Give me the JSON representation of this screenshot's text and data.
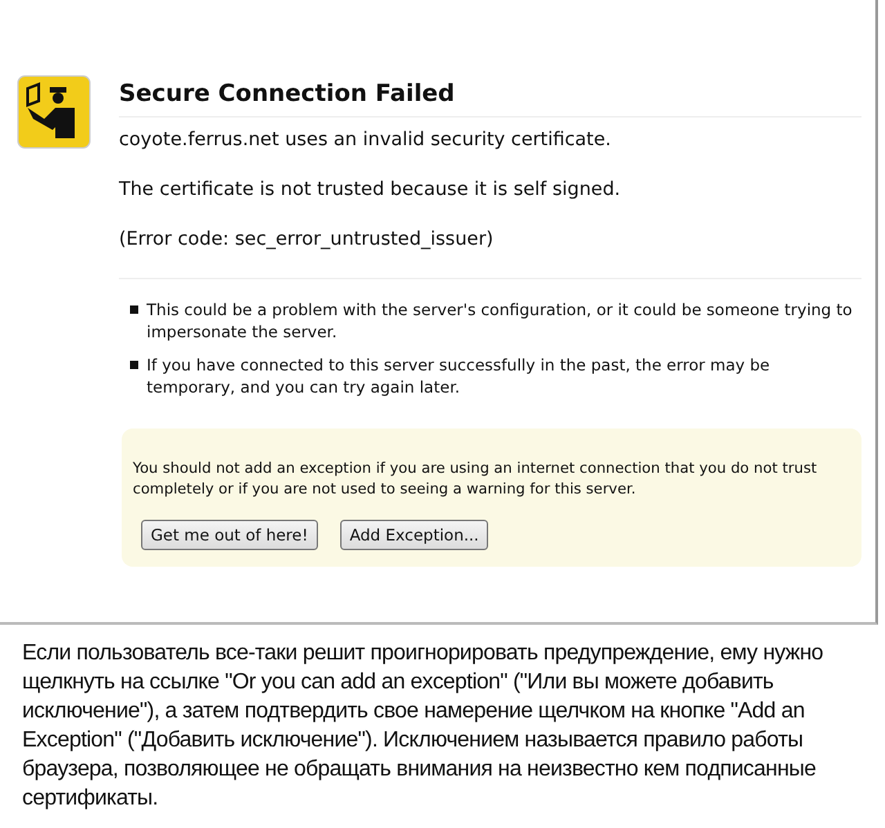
{
  "error_page": {
    "title": "Secure Connection Failed",
    "paragraphs": [
      "coyote.ferrus.net uses an invalid security certificate.",
      "The certificate is not trusted because it is self signed.",
      "(Error code: sec_error_untrusted_issuer)"
    ],
    "bullets": [
      "This could be a problem with the server's configuration, or it could be someone trying to impersonate the server.",
      "If you have connected to this server successfully in the past, the error may be temporary, and you can try again later."
    ],
    "warning": {
      "text": "You should not add an exception if you are using an internet connection that you do not trust completely or if you are not used to seeing a warning for this server.",
      "buttons": [
        "Get me out of here!",
        "Add Exception..."
      ]
    }
  },
  "caption": "Если пользователь все-таки решит проигнорировать предупреждение, ему нужно щелкнуть на ссылке \"Or you can add an exception\" (\"Или вы можете добавить исключение\"), а затем подтвердить свое намерение щелчком на кнопке \"Add an Exception\" (\"Добавить исключение\"). Исключением называется правило работы браузера, позволяющее не обращать внимания на неизвестно кем подписанные сертификаты."
}
